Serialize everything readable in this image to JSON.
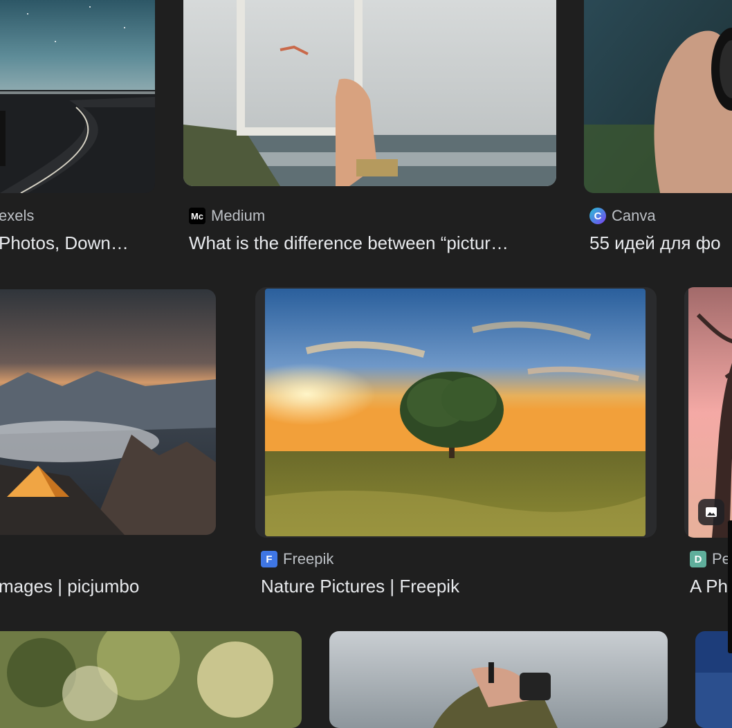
{
  "results": [
    {
      "id": "r1",
      "source": "exels",
      "title": " Photos, Down…"
    },
    {
      "id": "r2",
      "source": "Medium",
      "favicon": "Mс",
      "title": "What is the difference between “pictur…"
    },
    {
      "id": "r3",
      "source": "Canva",
      "favicon": "C",
      "title": "55 идей для фо"
    },
    {
      "id": "r4",
      "source": "",
      "title": "mages | picjumbo"
    },
    {
      "id": "r5",
      "source": "Freepik",
      "favicon": "F",
      "title": "Nature Pictures | Freepik"
    },
    {
      "id": "r6",
      "source": "Pe",
      "favicon": "D",
      "title": "A Ph"
    }
  ],
  "colors": {
    "background": "#1f1f1f",
    "source_text": "#bdc1c6",
    "title_text": "#e8eaed",
    "canva": "#7b3ff2",
    "freepik": "#3f76e4",
    "pexels_like": "#5fae9b"
  },
  "icons": [
    "medium-favicon-icon",
    "canva-favicon-icon",
    "freepik-favicon-icon",
    "pe-favicon-icon",
    "image-badge-icon"
  ]
}
